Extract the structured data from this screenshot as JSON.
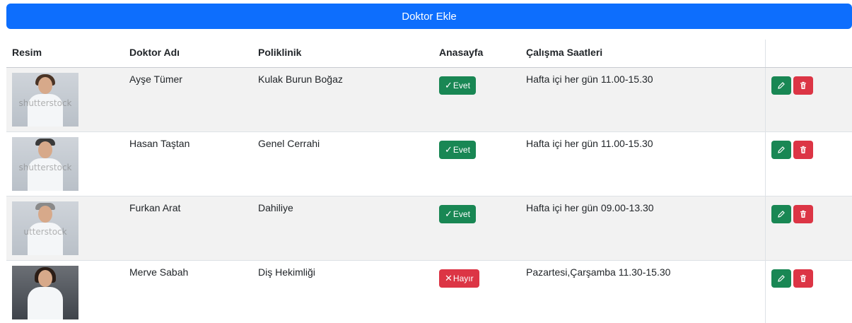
{
  "toolbar": {
    "add_label": "Doktor Ekle"
  },
  "table": {
    "headers": [
      "Resim",
      "Doktor Adı",
      "Poliklinik",
      "Anasayfa",
      "Çalışma Saatleri",
      ""
    ],
    "rows": [
      {
        "photo_watermark": "shutterstock",
        "name": "Ayşe Tümer",
        "clinic": "Kulak Burun Boğaz",
        "home": "Evet",
        "home_status": "yes",
        "hours": "Hafta içi her gün 11.00-15.30"
      },
      {
        "photo_watermark": "shutterstock",
        "name": "Hasan Taştan",
        "clinic": "Genel Cerrahi",
        "home": "Evet",
        "home_status": "yes",
        "hours": "Hafta içi her gün 11.00-15.30"
      },
      {
        "photo_watermark": "utterstock",
        "name": "Furkan Arat",
        "clinic": "Dahiliye",
        "home": "Evet",
        "home_status": "yes",
        "hours": "Hafta içi her gün 09.00-13.30"
      },
      {
        "photo_watermark": "",
        "name": "Merve Sabah",
        "clinic": "Diş Hekimliği",
        "home": "Hayır",
        "home_status": "no",
        "hours": "Pazartesi,Çarşamba 11.30-15.30"
      }
    ]
  },
  "icons": {
    "edit": "pencil-icon",
    "delete": "trash-icon",
    "yes": "check-icon",
    "no": "x-icon"
  },
  "colors": {
    "primary": "#0d6efd",
    "success": "#198754",
    "danger": "#dc3545"
  }
}
